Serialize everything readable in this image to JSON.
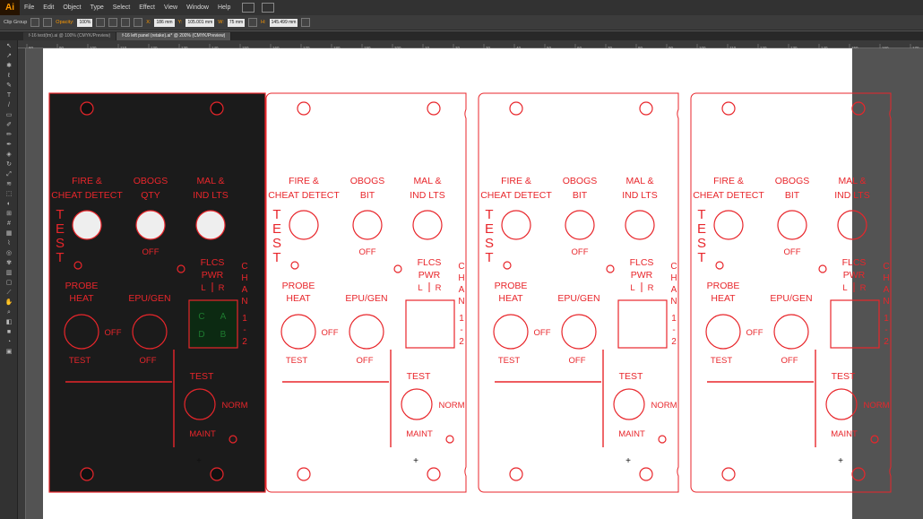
{
  "app": {
    "logo": "Ai"
  },
  "menu": [
    "File",
    "Edit",
    "Object",
    "Type",
    "Select",
    "Effect",
    "View",
    "Window",
    "Help"
  ],
  "control": {
    "selection": "Clip Group",
    "opacity_label": "Opacity:",
    "opacity_value": "100%",
    "x_label": "X:",
    "x_value": "186 mm",
    "y_label": "Y:",
    "y_value": "105.001 mm",
    "w_label": "W:",
    "w_value": "75 mm",
    "h_label": "H:",
    "h_value": "145.499 mm"
  },
  "tabs": [
    {
      "label": "f-16 test(tm).ai @ 100% (CMYK/Preview)"
    },
    {
      "label": "f-16 left panel (retake).ai* @ 200% (CMYK/Preview)"
    }
  ],
  "ruler_marks": [
    "80",
    "90",
    "100",
    "110",
    "120",
    "130",
    "140",
    "150",
    "160",
    "170",
    "180",
    "190",
    "200",
    "10",
    "20",
    "30",
    "40",
    "50",
    "60",
    "70",
    "80",
    "90",
    "100",
    "110",
    "120",
    "130",
    "140",
    "150",
    "160",
    "170"
  ],
  "panel": {
    "fire": "FIRE &",
    "cheat": "CHEAT DETECT",
    "obogs": "OBOGS",
    "bit": "BIT",
    "mal": "MAL &",
    "ind": "IND LTS",
    "test_letters": [
      "T",
      "E",
      "S",
      "T"
    ],
    "off": "OFF",
    "flcs": "FLCS",
    "pwr": "PWR",
    "l": "L",
    "r": "R",
    "chan_letters": [
      "C",
      "H",
      "A",
      "N"
    ],
    "chan_nums": [
      "1",
      "-",
      "2"
    ],
    "probe": "PROBE",
    "heat": "HEAT",
    "epu": "EPU/GEN",
    "test": "TEST",
    "norm": "NORM",
    "maint": "MAINT",
    "led_c": "C",
    "led_a": "A",
    "led_d": "D",
    "led_b": "B",
    "dark_obogs": "OBOGS",
    "dark_qty": "QTY"
  },
  "colors": {
    "red": "#e8262b",
    "dark": "#1b1b1b",
    "led": "#1e7a2f"
  }
}
